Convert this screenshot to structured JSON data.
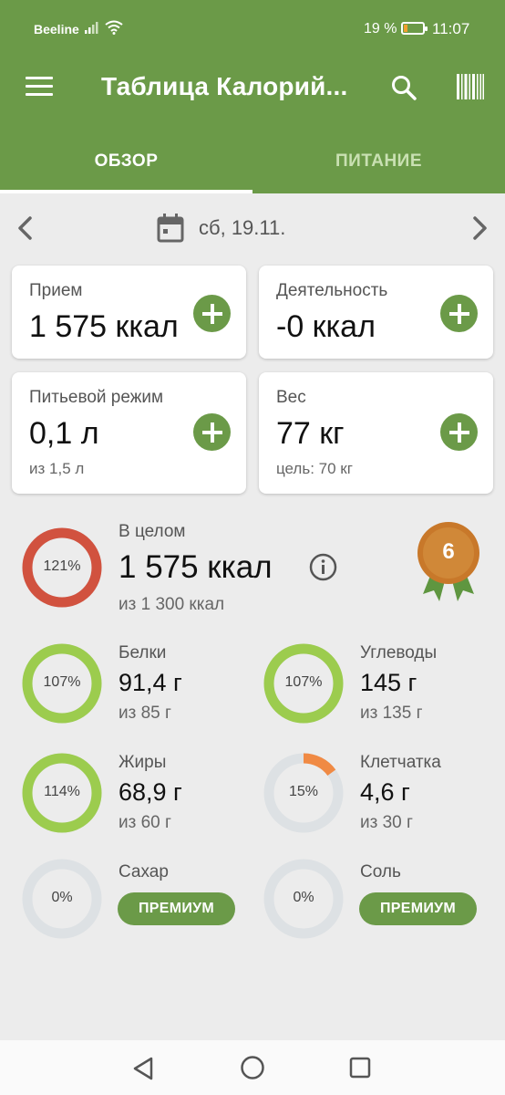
{
  "status_bar": {
    "carrier": "Beeline",
    "battery_percent": "19 %",
    "battery_level": 0.19,
    "time": "11:07"
  },
  "toolbar": {
    "title": "Таблица Калорий...",
    "menu_icon": "hamburger-menu-icon",
    "search_icon": "search-icon",
    "barcode_icon": "barcode-icon"
  },
  "tabs": [
    {
      "label": "ОБЗОР",
      "active": true
    },
    {
      "label": "ПИТАНИЕ",
      "active": false
    }
  ],
  "date": {
    "text": "сб, 19.11."
  },
  "cards": {
    "intake": {
      "label": "Прием",
      "value": "1 575 ккал"
    },
    "activity": {
      "label": "Деятельность",
      "value": "-0 ккал"
    },
    "water": {
      "label": "Питьевой режим",
      "value": "0,1 л",
      "sub": "из 1,5 л"
    },
    "weight": {
      "label": "Вес",
      "value": "77 кг",
      "sub": "цель: 70 кг"
    }
  },
  "overall": {
    "label": "В целом",
    "value": "1 575 ккал",
    "sub": "из 1 300 ккал",
    "percent": "121%",
    "fraction": 1.21,
    "color": "#d1523f"
  },
  "badge": {
    "number": "6",
    "color": "#c8782a"
  },
  "nutrients": {
    "protein": {
      "label": "Белки",
      "value": "91,4 г",
      "sub": "из 85 г",
      "percent": "107%",
      "fraction": 1.07,
      "color": "#9ccc4e"
    },
    "carbs": {
      "label": "Углеводы",
      "value": "145 г",
      "sub": "из 135 г",
      "percent": "107%",
      "fraction": 1.07,
      "color": "#9ccc4e"
    },
    "fat": {
      "label": "Жиры",
      "value": "68,9 г",
      "sub": "из 60 г",
      "percent": "114%",
      "fraction": 1.14,
      "color": "#9ccc4e"
    },
    "fiber": {
      "label": "Клетчатка",
      "value": "4,6 г",
      "sub": "из 30 г",
      "percent": "15%",
      "fraction": 0.15,
      "color": "#f08a44"
    },
    "sugar": {
      "label": "Сахар",
      "percent": "0%",
      "fraction": 0,
      "color": "#9ccc4e",
      "button": "ПРЕМИУМ"
    },
    "salt": {
      "label": "Соль",
      "percent": "0%",
      "fraction": 0,
      "color": "#9ccc4e",
      "button": "ПРЕМИУМ"
    }
  },
  "colors": {
    "primary": "#6b9a48",
    "ring_track": "#dde1e4",
    "background": "#ececec"
  }
}
